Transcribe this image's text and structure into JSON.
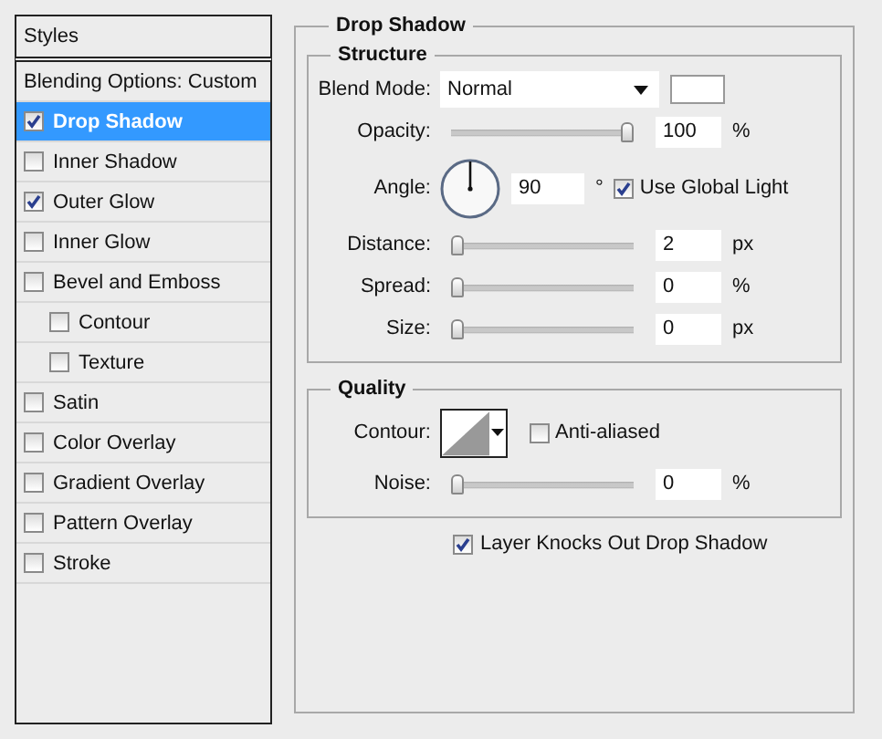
{
  "sidebar": {
    "title": "Styles",
    "items": [
      {
        "kind": "option",
        "label": "Blending Options: Custom",
        "selected": false
      },
      {
        "kind": "effect",
        "label": "Drop Shadow",
        "checked": true,
        "selected": true
      },
      {
        "kind": "effect",
        "label": "Inner Shadow",
        "checked": false,
        "selected": false
      },
      {
        "kind": "effect",
        "label": "Outer Glow",
        "checked": true,
        "selected": false
      },
      {
        "kind": "effect",
        "label": "Inner Glow",
        "checked": false,
        "selected": false
      },
      {
        "kind": "effect",
        "label": "Bevel and Emboss",
        "checked": false,
        "selected": false,
        "children": [
          {
            "kind": "effect",
            "label": "Contour",
            "checked": false,
            "selected": false
          },
          {
            "kind": "effect",
            "label": "Texture",
            "checked": false,
            "selected": false
          }
        ]
      },
      {
        "kind": "effect",
        "label": "Satin",
        "checked": false,
        "selected": false
      },
      {
        "kind": "effect",
        "label": "Color Overlay",
        "checked": false,
        "selected": false
      },
      {
        "kind": "effect",
        "label": "Gradient Overlay",
        "checked": false,
        "selected": false
      },
      {
        "kind": "effect",
        "label": "Pattern Overlay",
        "checked": false,
        "selected": false
      },
      {
        "kind": "effect",
        "label": "Stroke",
        "checked": false,
        "selected": false
      }
    ]
  },
  "panel": {
    "title": "Drop Shadow",
    "structure": {
      "title": "Structure",
      "controls": [
        {
          "kind": "select",
          "label": "Blend Mode:",
          "value": "Normal"
        },
        {
          "kind": "slider",
          "label": "Opacity:",
          "value": "100",
          "unit": "%",
          "level": 1
        },
        {
          "kind": "angle",
          "label": "Angle:",
          "value": "90",
          "unit": "°",
          "option": {
            "label": "Use Global Light",
            "checked": true
          }
        },
        {
          "kind": "slider",
          "label": "Distance:",
          "value": "2",
          "unit": "px",
          "level": 0
        },
        {
          "kind": "slider",
          "label": "Spread:",
          "value": "0",
          "unit": "%",
          "level": 0
        },
        {
          "kind": "slider",
          "label": "Size:",
          "value": "0",
          "unit": "px",
          "level": 0
        }
      ]
    },
    "quality": {
      "title": "Quality",
      "controls": [
        {
          "kind": "contour",
          "label": "Contour:",
          "option": {
            "label": "Anti-aliased",
            "checked": false
          }
        },
        {
          "kind": "slider",
          "label": "Noise:",
          "value": "0",
          "unit": "%",
          "level": 0
        }
      ]
    },
    "knockout": {
      "label": "Layer Knocks Out Drop Shadow",
      "checked": true
    }
  }
}
